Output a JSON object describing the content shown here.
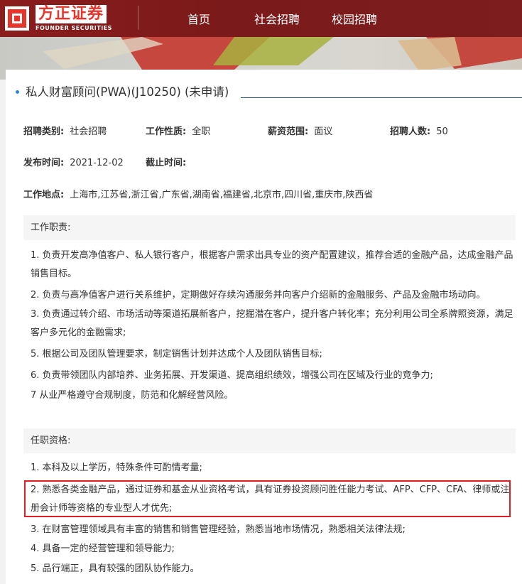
{
  "brand": {
    "name_cn": "方正证券",
    "name_en": "FOUNDER SECURITIES",
    "color": "#e8342a"
  },
  "nav": {
    "items": [
      {
        "label": "首页"
      },
      {
        "label": "社会招聘"
      },
      {
        "label": "校园招聘"
      }
    ]
  },
  "job": {
    "title": "私人财富顾问(PWA)(J10250) (未申请)",
    "category_label": "招聘类别:",
    "category": "社会招聘",
    "nature_label": "工作性质:",
    "nature": "全职",
    "salary_label": "薪资范围:",
    "salary": "面议",
    "headcount_label": "招聘人数:",
    "headcount": "50",
    "publish_label": "发布时间:",
    "publish_date": "2021-12-02",
    "deadline_label": "截止时间:",
    "deadline": "",
    "location_label": "工作地点:",
    "location": "上海市,江苏省,浙江省,广东省,湖南省,福建省,北京市,四川省,重庆市,陕西省"
  },
  "duties": {
    "heading": "工作职责:",
    "items": [
      "1. 负责开发高净值客户、私人银行客户，根据客户需求出具专业的资产配置建议，推荐合适的金融产品，达成金融产品销售目标。",
      "2. 负责与高净值客户进行关系维护，定期做好存续沟通服务并向客户介绍新的金融服务、产品及金融市场动向。",
      "3. 负责通过转介绍、市场活动等渠道拓展新客户，挖掘潜在客户，提升客户转化率；充分利用公司全系牌照资源，满足客户多元化的金融需求;",
      "5. 根据公司及团队管理要求，制定销售计划并达成个人及团队销售目标;",
      "6. 负责带领团队内部培养、业务拓展、开发渠道、提高组织绩效，增强公司在区域及行业的竞争力;",
      "7 从业严格遵守合规制度，防范和化解经营风险。"
    ]
  },
  "requirements": {
    "heading": "任职资格:",
    "items": [
      "1. 本科及以上学历，特殊条件可酌情考量;",
      "2. 熟悉各类金融产品，通过证券和基金从业资格考试，具有证券投资顾问胜任能力考试、AFP、CFP、CFA、律师或注册会计师等资格的专业型人才优先;",
      "3. 在财富管理领域具有丰富的销售和销售管理经验，熟悉当地市场情况，熟悉相关法律法规;",
      "4. 具备一定的经营管理和领导能力;",
      "5. 品行端正，具有较强的团队协作能力。"
    ]
  },
  "colors": {
    "nav_bg": "#7b1b1b",
    "highlight_border": "#e02020",
    "accent_blue": "#2a8ad8"
  }
}
